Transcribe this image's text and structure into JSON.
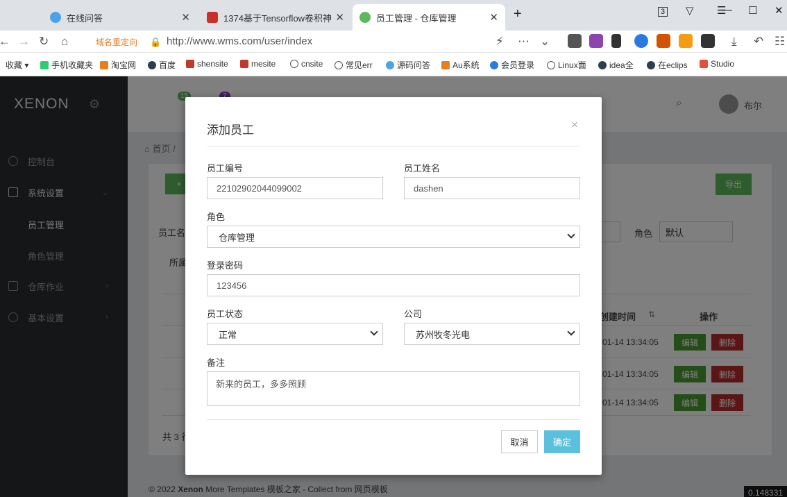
{
  "browser": {
    "tabs": [
      {
        "title": "在线问答"
      },
      {
        "title": "1374基于Tensorflow卷积神"
      },
      {
        "title": "员工管理 - 仓库管理"
      }
    ],
    "address": {
      "redirect_label": "域名重定向",
      "url": "http://www.wms.com/user/index"
    },
    "bookmarks": [
      "收藏",
      "手机收藏夹",
      "淘宝网",
      "百度",
      "shensite",
      "mesite",
      "cnsite",
      "常见err",
      "源码问答",
      "Au系统",
      "会员登录",
      "Linux面",
      "idea全",
      "在eclips",
      "Studio"
    ]
  },
  "app": {
    "logo": "XENON",
    "sidebar": {
      "items": [
        {
          "label": "控制台"
        },
        {
          "label": "系统设置"
        },
        {
          "label": "仓库作业"
        },
        {
          "label": "基本设置"
        }
      ],
      "sub_items": [
        {
          "label": "员工管理"
        },
        {
          "label": "角色管理"
        }
      ]
    },
    "topbar": {
      "badge1": "15",
      "badge2": "7",
      "user": "布尔"
    },
    "breadcrumb": "首页",
    "filters": {
      "label_name": "员工名",
      "label_belong": "所属",
      "label_role": "角色",
      "role_value": "默认"
    },
    "export_label": "导出",
    "table": {
      "col_create_time": "创建时间",
      "col_actions": "操作",
      "rows": [
        {
          "time": "01-14 13:34:05"
        },
        {
          "time": "01-14 13:34:05"
        },
        {
          "time": "01-14 13:34:05"
        }
      ],
      "edit_label": "编辑",
      "delete_label": "删除"
    },
    "total": "共 3 行",
    "footer": {
      "prefix": "© 2022",
      "brand": "Xenon",
      "suffix": "More Templates 模板之家 - Collect from 网页模板"
    },
    "corner_value": "0.148331"
  },
  "modal": {
    "title": "添加员工",
    "close": "×",
    "fields": {
      "emp_no_label": "员工编号",
      "emp_no": "22102902044099002",
      "emp_name_label": "员工姓名",
      "emp_name": "dashen",
      "role_label": "角色",
      "role": "仓库管理",
      "password_label": "登录密码",
      "password": "123456",
      "status_label": "员工状态",
      "status": "正常",
      "company_label": "公司",
      "company": "苏州牧冬光电",
      "note_label": "备注",
      "note": "新来的员工，多多照顾"
    },
    "cancel_label": "取消",
    "ok_label": "确定"
  },
  "colors": {
    "sidebar_bg": "#2b2d31",
    "primary_ok": "#5bc0de",
    "green": "#5cb85c",
    "danger": "#b52c2c"
  }
}
